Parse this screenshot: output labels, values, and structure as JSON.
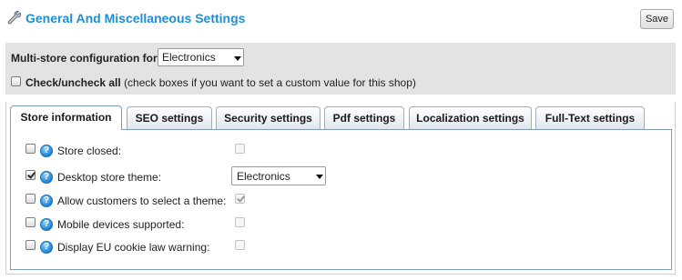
{
  "header": {
    "title": "General And Miscellaneous Settings",
    "save_label": "Save",
    "icon": "wrench-icon"
  },
  "multistore": {
    "label": "Multi-store configuration for",
    "selected_store": "Electronics",
    "check_all_label": "Check/uncheck all",
    "check_all_hint": "(check boxes if you want to set a custom value for this shop)",
    "check_all_checked": false
  },
  "tabs": [
    {
      "label": "Store information",
      "active": true
    },
    {
      "label": "SEO settings",
      "active": false
    },
    {
      "label": "Security settings",
      "active": false
    },
    {
      "label": "Pdf settings",
      "active": false
    },
    {
      "label": "Localization settings",
      "active": false
    },
    {
      "label": "Full-Text settings",
      "active": false
    }
  ],
  "options": [
    {
      "label": "Store closed:",
      "override": false,
      "control": "checkbox",
      "value": false,
      "enabled": false
    },
    {
      "label": "Desktop store theme:",
      "override": true,
      "control": "select",
      "value": "Electronics",
      "enabled": true
    },
    {
      "label": "Allow customers to select a theme:",
      "override": false,
      "control": "checkbox",
      "value": true,
      "enabled": false
    },
    {
      "label": "Mobile devices supported:",
      "override": false,
      "control": "checkbox",
      "value": false,
      "enabled": false
    },
    {
      "label": "Display EU cookie law warning:",
      "override": false,
      "control": "checkbox",
      "value": false,
      "enabled": false
    }
  ],
  "colors": {
    "title": "#1e8fd6",
    "config_bar": "#e3e3e3",
    "tab_border": "#7f9db3",
    "help_icon": "#1b82d2"
  }
}
